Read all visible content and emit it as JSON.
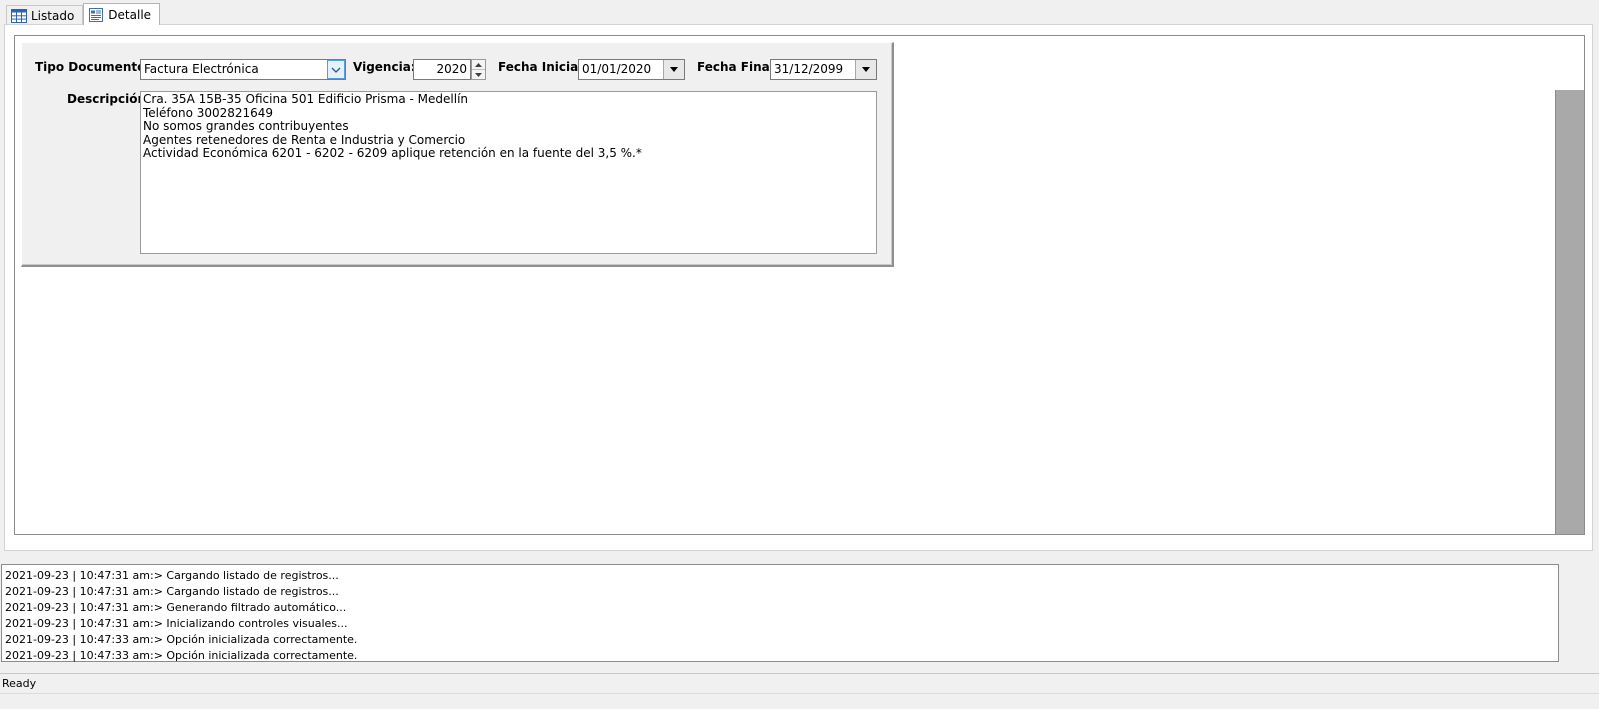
{
  "tabs": [
    {
      "label": "Listado",
      "icon": "table-icon",
      "active": false
    },
    {
      "label": "Detalle",
      "icon": "document-icon",
      "active": true
    }
  ],
  "form": {
    "tipo_documento_label": "Tipo Documento:",
    "tipo_documento_value": "Factura Electrónica",
    "vigencia_label": "Vigencia:",
    "vigencia_value": "2020",
    "fecha_inicial_label": "Fecha Inicial:",
    "fecha_inicial_value": "01/01/2020",
    "fecha_final_label": "Fecha Final:",
    "fecha_final_value": "31/12/2099",
    "descripcion_label": "Descripción:",
    "descripcion_lines": [
      "Cra. 35A 15B-35 Oficina 501 Edificio Prisma -  Medellín",
      "Teléfono 3002821649",
      "No somos grandes contribuyentes",
      "Agentes retenedores de Renta e Industria y Comercio",
      "Actividad Económica 6201 - 6202 - 6209 aplique retención en la fuente del 3,5 %.*"
    ]
  },
  "log": [
    "2021-09-23 | 10:47:31 am:>  Cargando listado de registros...",
    "2021-09-23 | 10:47:31 am:>  Cargando listado de registros...",
    "2021-09-23 | 10:47:31 am:>  Generando filtrado automático...",
    "2021-09-23 | 10:47:31 am:>  Inicializando controles visuales...",
    "2021-09-23 | 10:47:33 am:>  Opción inicializada correctamente.",
    "2021-09-23 | 10:47:33 am:>  Opción inicializada correctamente."
  ],
  "status": "Ready",
  "colors": {
    "accent_blue": "#569de5",
    "scrollbar": "#a9a9a9",
    "background": "#f0f0f0"
  }
}
